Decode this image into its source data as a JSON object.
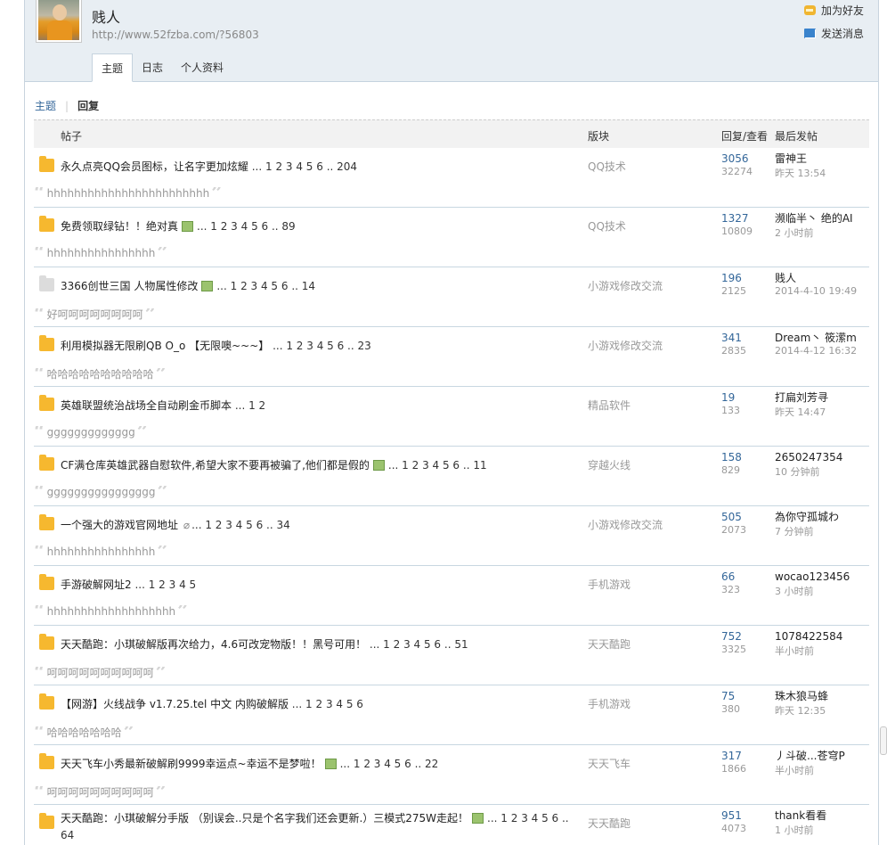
{
  "profile": {
    "name": "贱人",
    "url": "http://www.52fzba.com/?56803",
    "add_friend": "加为好友",
    "send_message": "发送消息"
  },
  "tabs": [
    "主题",
    "日志",
    "个人资料"
  ],
  "subnav": {
    "topics": "主题",
    "sep": "|",
    "replies": "回复"
  },
  "table_header": {
    "post": "帖子",
    "forum": "版块",
    "reply_view": "回复/查看",
    "last_post": "最后发帖"
  },
  "rows": [
    {
      "title": "永久点亮QQ会员图标，让名字更加炫耀",
      "img": false,
      "clip": false,
      "pages": "... 1 2 3 4 5 6 .. 204",
      "forum": "QQ技术",
      "replies": "3056",
      "views": "32274",
      "last_user": "雷神王",
      "last_time": "昨天 13:54",
      "quote": "hhhhhhhhhhhhhhhhhhhhhhhh"
    },
    {
      "title": "免费领取绿钻！！绝对真",
      "img": true,
      "clip": false,
      "pages": "... 1 2 3 4 5 6 .. 89",
      "forum": "QQ技术",
      "replies": "1327",
      "views": "10809",
      "last_user": "濒临半丶 绝的AI",
      "last_time": "2 小时前",
      "quote": "hhhhhhhhhhhhhhhh"
    },
    {
      "title": "3366创世三国 人物属性修改",
      "img": true,
      "clip": false,
      "pages": "... 1 2 3 4 5 6 .. 14",
      "forum": "小游戏修改交流",
      "replies": "196",
      "views": "2125",
      "last_user": "贱人",
      "last_time": "2014-4-10 19:49",
      "quote": "好呵呵呵呵呵呵呵呵",
      "grey": true
    },
    {
      "title": "利用模拟器无限刷QB O_o 【无限噢~~~】",
      "img": false,
      "clip": false,
      "pages": "... 1 2 3 4 5 6 .. 23",
      "forum": "小游戏修改交流",
      "replies": "341",
      "views": "2835",
      "last_user": "Dream丶 筱潆m",
      "last_time": "2014-4-12 16:32",
      "quote": "哈哈哈哈哈哈哈哈哈哈"
    },
    {
      "title": "英雄联盟统治战场全自动刷金币脚本",
      "img": false,
      "clip": false,
      "pages": "... 1 2",
      "forum": "精品软件",
      "replies": "19",
      "views": "133",
      "last_user": "打扁刘芳寻",
      "last_time": "昨天 14:47",
      "quote": "ggggggggggggg"
    },
    {
      "title": "CF满仓库英雄武器自慰软件,希望大家不要再被骗了,他们都是假的",
      "img": true,
      "clip": false,
      "pages": "... 1 2 3 4 5 6 .. 11",
      "forum": "穿越火线",
      "replies": "158",
      "views": "829",
      "last_user": "2650247354",
      "last_time": "10 分钟前",
      "quote": "gggggggggggggggg"
    },
    {
      "title": "一个强大的游戏官网地址",
      "img": false,
      "clip": true,
      "pages": "... 1 2 3 4 5 6 .. 34",
      "forum": "小游戏修改交流",
      "replies": "505",
      "views": "2073",
      "last_user": "為你守孤城わ",
      "last_time": "7 分钟前",
      "quote": "hhhhhhhhhhhhhhhh"
    },
    {
      "title": "手游破解网址2",
      "img": false,
      "clip": false,
      "pages": "... 1 2 3 4 5",
      "forum": "手机游戏",
      "replies": "66",
      "views": "323",
      "last_user": "wocao123456",
      "last_time": "3 小时前",
      "quote": "hhhhhhhhhhhhhhhhhhh"
    },
    {
      "title": "天天酷跑：小琪破解版再次给力，4.6可改宠物版！！黑号可用！",
      "img": false,
      "clip": false,
      "pages": "... 1 2 3 4 5 6 .. 51",
      "forum": "天天酷跑",
      "replies": "752",
      "views": "3325",
      "last_user": "1078422584",
      "last_time": "半小时前",
      "quote": "呵呵呵呵呵呵呵呵呵呵"
    },
    {
      "title": "【网游】火线战争 v1.7.25.tel 中文 内购破解版",
      "img": false,
      "clip": false,
      "pages": "... 1 2 3 4 5 6",
      "forum": "手机游戏",
      "replies": "75",
      "views": "380",
      "last_user": "珠木狼马蜂",
      "last_time": "昨天 12:35",
      "quote": "哈哈哈哈哈哈哈"
    },
    {
      "title": "天天飞车小秀最新破解刷9999幸运点~幸运不是梦啦！",
      "img": true,
      "clip": false,
      "pages": "... 1 2 3 4 5 6 .. 22",
      "forum": "天天飞车",
      "replies": "317",
      "views": "1866",
      "last_user": "丿斗破...苍穹P",
      "last_time": "半小时前",
      "quote": "呵呵呵呵呵呵呵呵呵呵"
    },
    {
      "title": "天天酷跑：小琪破解分手版 （别误会..只是个名字我们还会更新.）三模式275W走起！",
      "img": true,
      "clip": false,
      "pages": "... 1 2 3 4 5 6 .. 64",
      "forum": "天天酷跑",
      "replies": "951",
      "views": "4073",
      "last_user": "thank看看",
      "last_time": "1 小时前",
      "quote": "",
      "tall": true
    }
  ],
  "icons": {
    "friend": "add-friend-icon",
    "message": "envelope-icon",
    "folder": "folder-icon",
    "image": "image-icon",
    "attachment": "paperclip-icon"
  },
  "colors": {
    "link": "#336699",
    "folder": "#f6b82f",
    "header_bg": "#e8eef3"
  }
}
